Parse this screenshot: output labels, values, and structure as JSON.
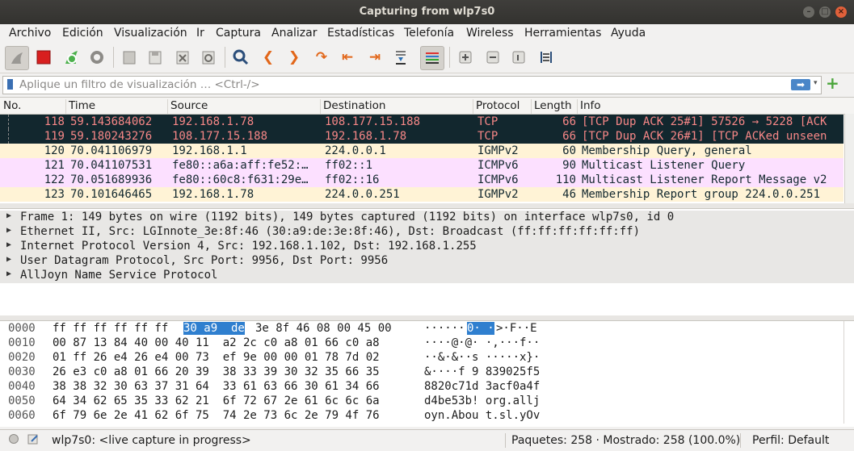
{
  "window": {
    "title": "Capturing from wlp7s0",
    "buttons": [
      "–",
      "□",
      "×"
    ]
  },
  "menu": [
    "Archivo",
    "Edición",
    "Visualización",
    "Ir",
    "Captura",
    "Analizar",
    "Estadísticas",
    "Telefonía",
    "Wireless",
    "Herramientas",
    "Ayuda"
  ],
  "toolbar_icons": [
    "shark-fin-icon",
    "stop-capture-icon",
    "restart-capture-icon",
    "capture-options-icon",
    "open-file-icon",
    "save-file-icon",
    "close-file-icon",
    "reload-file-icon",
    "find-packet-icon",
    "go-back-icon",
    "go-forward-icon",
    "go-to-packet-icon",
    "go-first-icon",
    "go-last-icon",
    "autoscroll-icon",
    "colorize-icon",
    "zoom-in-icon",
    "zoom-out-icon",
    "normal-size-icon",
    "resize-columns-icon"
  ],
  "filter": {
    "placeholder": "Aplique un filtro de visualización … <Ctrl-/>",
    "apply_icon": "arrow-right-icon",
    "dropdown_icon": "dropdown-icon",
    "add_icon": "plus-icon"
  },
  "packet_list": {
    "columns": [
      "No.",
      "Time",
      "Source",
      "Destination",
      "Protocol",
      "Length",
      "Info"
    ],
    "rows": [
      {
        "no": "118",
        "time": "59.143684062",
        "source": "192.168.1.78",
        "destination": "108.177.15.188",
        "protocol": "TCP",
        "length": "66",
        "info": "[TCP Dup ACK 25#1] 57526 → 5228 [ACK",
        "bg": "#12272e",
        "fg": "#f78787"
      },
      {
        "no": "119",
        "time": "59.180243276",
        "source": "108.177.15.188",
        "destination": "192.168.1.78",
        "protocol": "TCP",
        "length": "66",
        "info": "[TCP Dup ACK 26#1] [TCP ACKed unseen",
        "bg": "#12272e",
        "fg": "#f78787"
      },
      {
        "no": "120",
        "time": "70.041106979",
        "source": "192.168.1.1",
        "destination": "224.0.0.1",
        "protocol": "IGMPv2",
        "length": "60",
        "info": "Membership Query, general",
        "bg": "#fff3d6",
        "fg": "#12272e"
      },
      {
        "no": "121",
        "time": "70.041107531",
        "source": "fe80::a6a:aff:fe52:…",
        "destination": "ff02::1",
        "protocol": "ICMPv6",
        "length": "90",
        "info": "Multicast Listener Query",
        "bg": "#fce0ff",
        "fg": "#12272e"
      },
      {
        "no": "122",
        "time": "70.051689936",
        "source": "fe80::60c8:f631:29e…",
        "destination": "ff02::16",
        "protocol": "ICMPv6",
        "length": "110",
        "info": "Multicast Listener Report Message v2",
        "bg": "#fce0ff",
        "fg": "#12272e"
      },
      {
        "no": "123",
        "time": "70.101646465",
        "source": "192.168.1.78",
        "destination": "224.0.0.251",
        "protocol": "IGMPv2",
        "length": "46",
        "info": "Membership Report group 224.0.0.251",
        "bg": "#fff3d6",
        "fg": "#12272e"
      }
    ]
  },
  "details": [
    "Frame 1: 149 bytes on wire (1192 bits), 149 bytes captured (1192 bits) on interface wlp7s0, id 0",
    "Ethernet II, Src: LGInnote_3e:8f:46 (30:a9:de:3e:8f:46), Dst: Broadcast (ff:ff:ff:ff:ff:ff)",
    "Internet Protocol Version 4, Src: 192.168.1.102, Dst: 192.168.1.255",
    "User Datagram Protocol, Src Port: 9956, Dst Port: 9956",
    "AllJoyn Name Service Protocol"
  ],
  "bytes": [
    {
      "offset": "0000",
      "hex_a": "ff ff ff ff ff ff",
      "hex_hl": "30 a9  de",
      "hex_b": "3e 8f 46 08 00 45 00",
      "ascii_a": "······",
      "ascii_hl": "0· ·",
      "ascii_b": ">·F··E"
    },
    {
      "offset": "0010",
      "hex": "00 87 13 84 40 00 40 11  a2 2c c0 a8 01 66 c0 a8",
      "ascii": "····@·@· ·,···f··"
    },
    {
      "offset": "0020",
      "hex": "01 ff 26 e4 26 e4 00 73  ef 9e 00 00 01 78 7d 02",
      "ascii": "··&·&··s ·····x}·"
    },
    {
      "offset": "0030",
      "hex": "26 e3 c0 a8 01 66 20 39  38 33 39 30 32 35 66 35",
      "ascii": "&····f 9 839025f5"
    },
    {
      "offset": "0040",
      "hex": "38 38 32 30 63 37 31 64  33 61 63 66 30 61 34 66",
      "ascii": "8820c71d 3acf0a4f"
    },
    {
      "offset": "0050",
      "hex": "64 34 62 65 35 33 62 21  6f 72 67 2e 61 6c 6c 6a",
      "ascii": "d4be53b! org.allj"
    },
    {
      "offset": "0060",
      "hex": "6f 79 6e 2e 41 62 6f 75  74 2e 73 6c 2e 79 4f 76",
      "ascii": "oyn.Abou t.sl.yOv"
    }
  ],
  "status": {
    "interface": "wlp7s0: <live capture in progress>",
    "packets": "Paquetes: 258 · Mostrado: 258 (100.0%)",
    "profile": "Perfil: Default"
  }
}
